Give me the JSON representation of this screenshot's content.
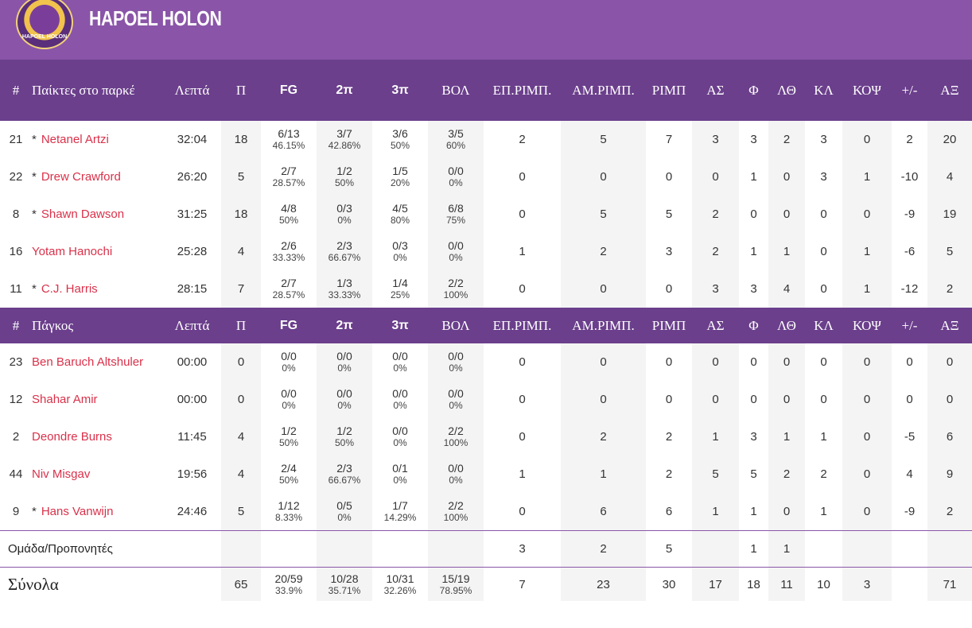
{
  "team": {
    "name": "HAPOEL HOLON",
    "logo_text": "HAPOEL HOLON",
    "color": "#8a55a8"
  },
  "sections": {
    "starters_title": "Παίκτες στο παρκέ",
    "bench_title": "Πάγκος"
  },
  "columns": {
    "num": "#",
    "min": "Λεπτά",
    "pts": "Π",
    "fg": "FG",
    "p2": "2π",
    "p3": "3π",
    "ft": "ΒΟΛ",
    "oreb": "ΕΠ.ΡΙΜΠ.",
    "dreb": "ΑΜ.ΡΙΜΠ.",
    "reb": "ΡΙΜΠ",
    "ast": "ΑΣ",
    "blk": "Φ",
    "to": "ΛΘ",
    "stl": "ΚΛ",
    "cut": "ΚΟΨ",
    "pm": "+/-",
    "val": "ΑΞ"
  },
  "starters": [
    {
      "num": "21",
      "star": true,
      "name": "Netanel Artzi",
      "min": "32:04",
      "pts": "18",
      "fg": "6/13",
      "fg_pct": "46.15%",
      "p2": "3/7",
      "p2_pct": "42.86%",
      "p3": "3/6",
      "p3_pct": "50%",
      "ft": "3/5",
      "ft_pct": "60%",
      "oreb": "2",
      "dreb": "5",
      "reb": "7",
      "ast": "3",
      "blk": "3",
      "to": "2",
      "stl": "3",
      "cut": "0",
      "pm": "2",
      "val": "20"
    },
    {
      "num": "22",
      "star": true,
      "name": "Drew Crawford",
      "min": "26:20",
      "pts": "5",
      "fg": "2/7",
      "fg_pct": "28.57%",
      "p2": "1/2",
      "p2_pct": "50%",
      "p3": "1/5",
      "p3_pct": "20%",
      "ft": "0/0",
      "ft_pct": "0%",
      "oreb": "0",
      "dreb": "0",
      "reb": "0",
      "ast": "0",
      "blk": "1",
      "to": "0",
      "stl": "3",
      "cut": "1",
      "pm": "-10",
      "val": "4"
    },
    {
      "num": "8",
      "star": true,
      "name": "Shawn Dawson",
      "min": "31:25",
      "pts": "18",
      "fg": "4/8",
      "fg_pct": "50%",
      "p2": "0/3",
      "p2_pct": "0%",
      "p3": "4/5",
      "p3_pct": "80%",
      "ft": "6/8",
      "ft_pct": "75%",
      "oreb": "0",
      "dreb": "5",
      "reb": "5",
      "ast": "2",
      "blk": "0",
      "to": "0",
      "stl": "0",
      "cut": "0",
      "pm": "-9",
      "val": "19"
    },
    {
      "num": "16",
      "star": false,
      "name": "Yotam Hanochi",
      "min": "25:28",
      "pts": "4",
      "fg": "2/6",
      "fg_pct": "33.33%",
      "p2": "2/3",
      "p2_pct": "66.67%",
      "p3": "0/3",
      "p3_pct": "0%",
      "ft": "0/0",
      "ft_pct": "0%",
      "oreb": "1",
      "dreb": "2",
      "reb": "3",
      "ast": "2",
      "blk": "1",
      "to": "1",
      "stl": "0",
      "cut": "1",
      "pm": "-6",
      "val": "5"
    },
    {
      "num": "11",
      "star": true,
      "name": "C.J. Harris",
      "min": "28:15",
      "pts": "7",
      "fg": "2/7",
      "fg_pct": "28.57%",
      "p2": "1/3",
      "p2_pct": "33.33%",
      "p3": "1/4",
      "p3_pct": "25%",
      "ft": "2/2",
      "ft_pct": "100%",
      "oreb": "0",
      "dreb": "0",
      "reb": "0",
      "ast": "3",
      "blk": "3",
      "to": "4",
      "stl": "0",
      "cut": "1",
      "pm": "-12",
      "val": "2"
    }
  ],
  "bench": [
    {
      "num": "23",
      "star": false,
      "name": "Ben Baruch Altshuler",
      "min": "00:00",
      "pts": "0",
      "fg": "0/0",
      "fg_pct": "0%",
      "p2": "0/0",
      "p2_pct": "0%",
      "p3": "0/0",
      "p3_pct": "0%",
      "ft": "0/0",
      "ft_pct": "0%",
      "oreb": "0",
      "dreb": "0",
      "reb": "0",
      "ast": "0",
      "blk": "0",
      "to": "0",
      "stl": "0",
      "cut": "0",
      "pm": "0",
      "val": "0"
    },
    {
      "num": "12",
      "star": false,
      "name": "Shahar Amir",
      "min": "00:00",
      "pts": "0",
      "fg": "0/0",
      "fg_pct": "0%",
      "p2": "0/0",
      "p2_pct": "0%",
      "p3": "0/0",
      "p3_pct": "0%",
      "ft": "0/0",
      "ft_pct": "0%",
      "oreb": "0",
      "dreb": "0",
      "reb": "0",
      "ast": "0",
      "blk": "0",
      "to": "0",
      "stl": "0",
      "cut": "0",
      "pm": "0",
      "val": "0"
    },
    {
      "num": "2",
      "star": false,
      "name": "Deondre Burns",
      "min": "11:45",
      "pts": "4",
      "fg": "1/2",
      "fg_pct": "50%",
      "p2": "1/2",
      "p2_pct": "50%",
      "p3": "0/0",
      "p3_pct": "0%",
      "ft": "2/2",
      "ft_pct": "100%",
      "oreb": "0",
      "dreb": "2",
      "reb": "2",
      "ast": "1",
      "blk": "3",
      "to": "1",
      "stl": "1",
      "cut": "0",
      "pm": "-5",
      "val": "6"
    },
    {
      "num": "44",
      "star": false,
      "name": "Niv Misgav",
      "min": "19:56",
      "pts": "4",
      "fg": "2/4",
      "fg_pct": "50%",
      "p2": "2/3",
      "p2_pct": "66.67%",
      "p3": "0/1",
      "p3_pct": "0%",
      "ft": "0/0",
      "ft_pct": "0%",
      "oreb": "1",
      "dreb": "1",
      "reb": "2",
      "ast": "5",
      "blk": "5",
      "to": "2",
      "stl": "2",
      "cut": "0",
      "pm": "4",
      "val": "9"
    },
    {
      "num": "9",
      "star": true,
      "name": "Hans Vanwijn",
      "min": "24:46",
      "pts": "5",
      "fg": "1/12",
      "fg_pct": "8.33%",
      "p2": "0/5",
      "p2_pct": "0%",
      "p3": "1/7",
      "p3_pct": "14.29%",
      "ft": "2/2",
      "ft_pct": "100%",
      "oreb": "0",
      "dreb": "6",
      "reb": "6",
      "ast": "1",
      "blk": "1",
      "to": "0",
      "stl": "1",
      "cut": "0",
      "pm": "-9",
      "val": "2"
    }
  ],
  "team_row": {
    "label": "Ομάδα/Προπονητές",
    "oreb": "3",
    "dreb": "2",
    "reb": "5",
    "blk": "1",
    "to": "1"
  },
  "totals": {
    "label": "Σύνολα",
    "pts": "65",
    "fg": "20/59",
    "fg_pct": "33.9%",
    "p2": "10/28",
    "p2_pct": "35.71%",
    "p3": "10/31",
    "p3_pct": "32.26%",
    "ft": "15/19",
    "ft_pct": "78.95%",
    "oreb": "7",
    "dreb": "23",
    "reb": "30",
    "ast": "17",
    "blk": "18",
    "to": "11",
    "stl": "10",
    "cut": "3",
    "val": "71"
  }
}
